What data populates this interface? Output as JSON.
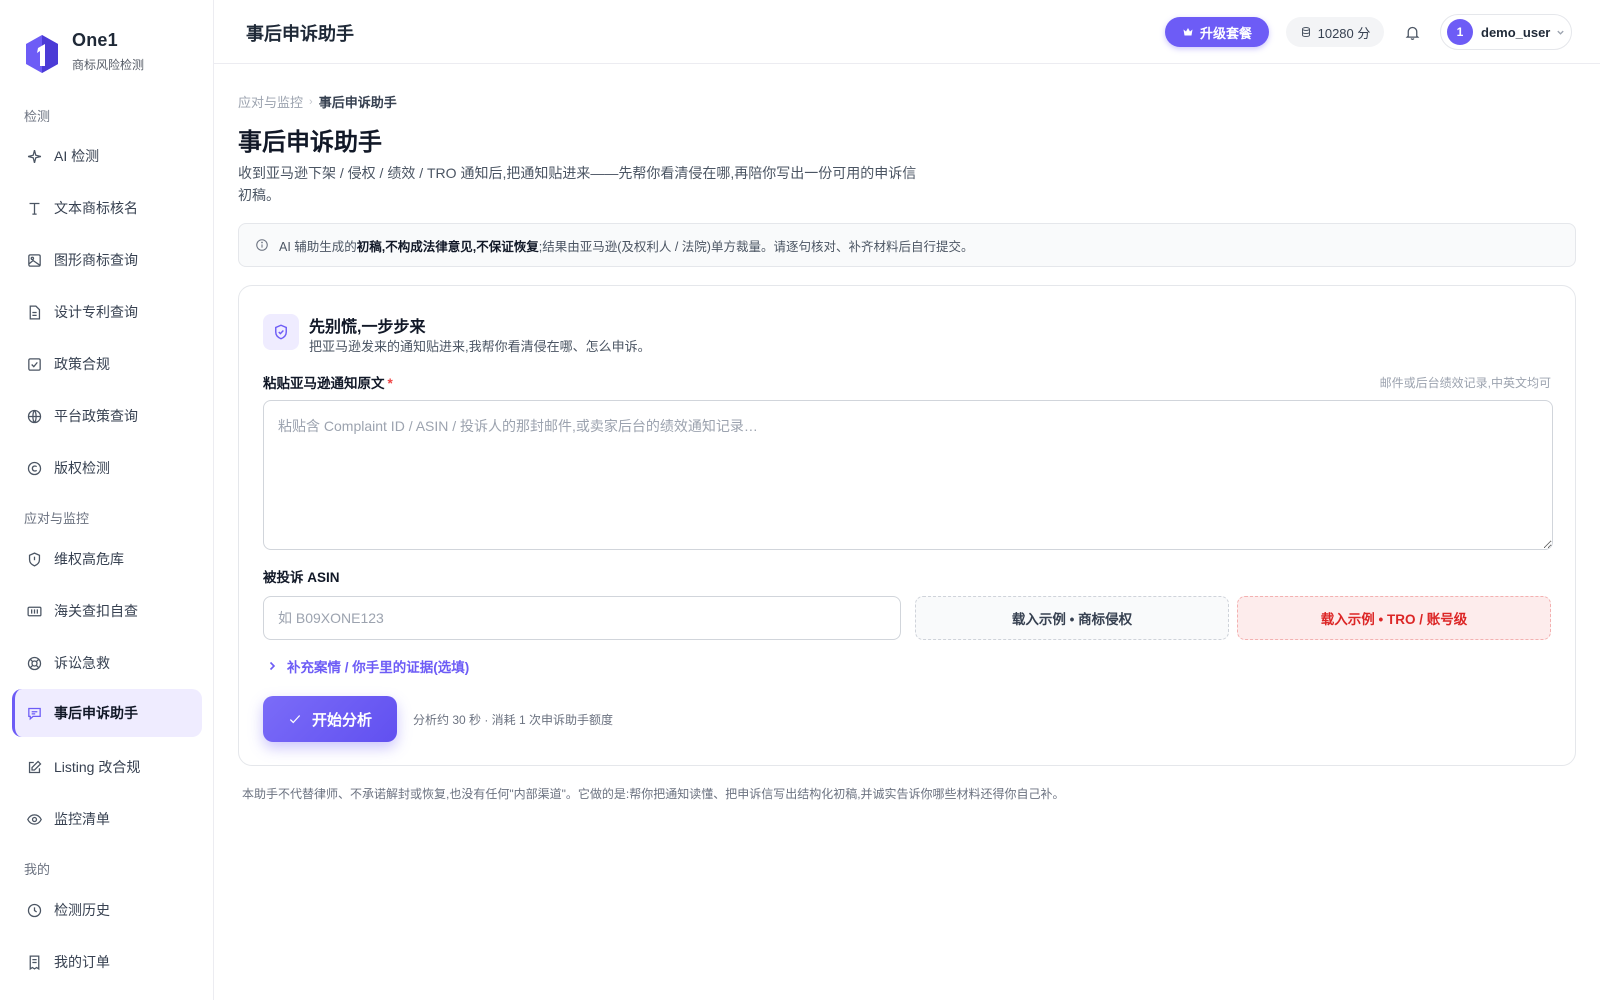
{
  "brand": {
    "name": "One1",
    "subtitle": "商标风险检测",
    "logo_icon": "hexagon-1-logo-icon"
  },
  "sidebar": {
    "sections": [
      {
        "label": "检测",
        "items": [
          {
            "label": "AI 检测",
            "icon": "sparkle-icon"
          },
          {
            "label": "文本商标核名",
            "icon": "text-icon"
          },
          {
            "label": "图形商标查询",
            "icon": "image-icon"
          },
          {
            "label": "设计专利查询",
            "icon": "document-icon"
          },
          {
            "label": "政策合规",
            "icon": "checkbox-icon"
          },
          {
            "label": "平台政策查询",
            "icon": "globe-icon"
          },
          {
            "label": "版权检测",
            "icon": "copyright-icon"
          }
        ]
      },
      {
        "label": "应对与监控",
        "items": [
          {
            "label": "维权高危库",
            "icon": "shield-icon"
          },
          {
            "label": "海关查扣自查",
            "icon": "container-icon"
          },
          {
            "label": "诉讼急救",
            "icon": "lifebuoy-icon"
          },
          {
            "label": "事后申诉助手",
            "icon": "chat-icon",
            "active": true
          },
          {
            "label": "Listing 改合规",
            "icon": "edit-icon"
          },
          {
            "label": "监控清单",
            "icon": "eye-icon"
          }
        ]
      },
      {
        "label": "我的",
        "items": [
          {
            "label": "检测历史",
            "icon": "clock-icon"
          },
          {
            "label": "我的订单",
            "icon": "receipt-icon"
          }
        ]
      }
    ]
  },
  "header": {
    "title": "事后申诉助手",
    "upgrade_label": "升级套餐",
    "points": "10280 分",
    "user": {
      "avatar_text": "1",
      "name": "demo_user"
    }
  },
  "breadcrumb": {
    "parent": "应对与监控",
    "separator": "›",
    "current": "事后申诉助手"
  },
  "page": {
    "title": "事后申诉助手",
    "description": "收到亚马逊下架 / 侵权 / 绩效 / TRO 通知后,把通知贴进来——先帮你看清侵在哪,再陪你写出一份可用的申诉信初稿。"
  },
  "notice": {
    "prefix": "AI 辅助生成的",
    "bold": "初稿,不构成法律意见,不保证恢复",
    "suffix": ";结果由亚马逊(及权利人 / 法院)单方裁量。请逐句核对、补齐材料后自行提交。"
  },
  "card": {
    "title": "先别慌,一步步来",
    "subtitle": "把亚马逊发来的通知贴进来,我帮你看清侵在哪、怎么申诉。",
    "notice_field": {
      "label": "粘贴亚马逊通知原文",
      "required_mark": "*",
      "hint": "邮件或后台绩效记录,中英文均可",
      "placeholder": "粘贴含 Complaint ID / ASIN / 投诉人的那封邮件,或卖家后台的绩效通知记录…",
      "value": ""
    },
    "asin_field": {
      "label": "被投诉 ASIN",
      "placeholder": "如 B09XONE123",
      "value": ""
    },
    "example_trademark": "载入示例 • 商标侵权",
    "example_tro": "载入示例 • TRO / 账号级",
    "supplement_link": "补充案情 / 你手里的证据(选填)",
    "start_button": "开始分析",
    "start_hint": "分析约 30 秒 · 消耗 1 次申诉助手额度"
  },
  "footnote": "本助手不代替律师、不承诺解封或恢复,也没有任何\"内部渠道\"。它做的是:帮你把通知读懂、把申诉信写出结构化初稿,并诚实告诉你哪些材料还得你自己补。",
  "colors": {
    "accent": "#6d5cf6",
    "danger": "#dc2626",
    "danger_bg": "#fdecec"
  }
}
